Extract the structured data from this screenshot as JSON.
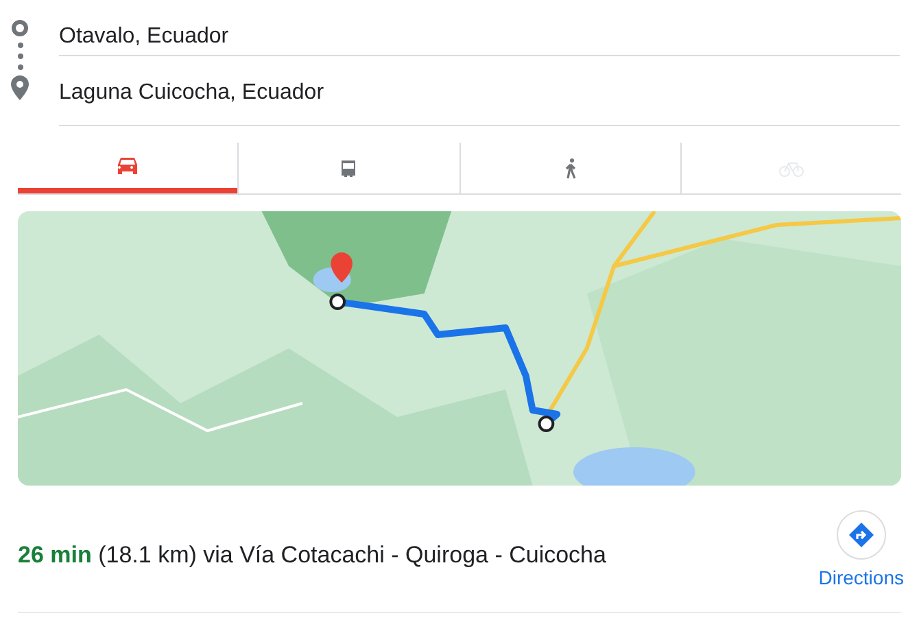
{
  "route": {
    "origin": "Otavalo, Ecuador",
    "destination": "Laguna Cuicocha, Ecuador"
  },
  "modes": [
    {
      "kind": "car",
      "selected": true,
      "disabled": false
    },
    {
      "kind": "transit",
      "selected": false,
      "disabled": false
    },
    {
      "kind": "walk",
      "selected": false,
      "disabled": false
    },
    {
      "kind": "bike",
      "selected": false,
      "disabled": true
    }
  ],
  "summary": {
    "duration": "26 min",
    "details": "(18.1 km) via Vía Cotacachi - Quiroga - Cuicocha",
    "action": "Directions"
  }
}
